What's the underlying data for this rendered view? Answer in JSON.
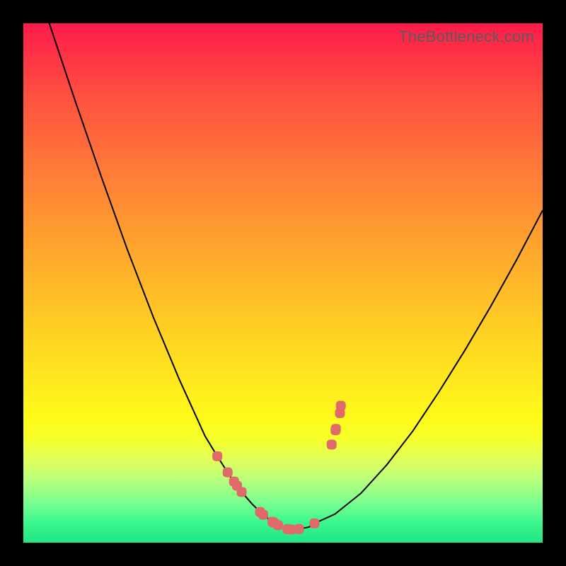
{
  "watermark": "TheBottleneck.com",
  "colors": {
    "frame": "#000000",
    "marker": "#e06a6a",
    "line": "#000000"
  },
  "chart_data": {
    "type": "line",
    "title": "",
    "xlabel": "",
    "ylabel": "",
    "xlim": [
      0,
      100
    ],
    "ylim": [
      0,
      100
    ],
    "grid": false,
    "legend": false,
    "series": [
      {
        "name": "bottleneck-curve",
        "x": [
          0,
          5,
          10,
          15,
          20,
          25,
          30,
          35,
          37.346,
          40,
          42,
          44,
          46,
          48,
          49,
          50,
          51,
          52,
          53,
          55,
          56.061,
          60,
          65,
          70,
          75,
          80,
          85,
          90,
          95,
          100
        ],
        "y": [
          115,
          100,
          85,
          70.5,
          56.5,
          43.5,
          31.5,
          20.5,
          16.638,
          12.5,
          9.8,
          7.5,
          5.5,
          4,
          3.4,
          2.9,
          2.6,
          2.5,
          2.6,
          3,
          3.72,
          5.5,
          9.5,
          15,
          21.5,
          29,
          37,
          45.5,
          54.5,
          64
        ]
      }
    ],
    "markers": [
      {
        "x": 37.346,
        "y": 16.638
      },
      {
        "x": 39.34,
        "y": 13.54
      },
      {
        "x": 40.567,
        "y": 11.77
      },
      {
        "x": 41.146,
        "y": 10.966
      },
      {
        "x": 42.031,
        "y": 9.762
      },
      {
        "x": 45.573,
        "y": 5.909
      },
      {
        "x": 46.185,
        "y": 5.363
      },
      {
        "x": 47.957,
        "y": 4.02
      },
      {
        "x": 48.093,
        "y": 3.93
      },
      {
        "x": 48.229,
        "y": 3.841
      },
      {
        "x": 49.047,
        "y": 3.363
      },
      {
        "x": 50.852,
        "y": 2.62
      },
      {
        "x": 51.567,
        "y": 2.523
      },
      {
        "x": 53.066,
        "y": 2.63
      },
      {
        "x": 56.061,
        "y": 3.72
      },
      {
        "x": 59.364,
        "y": 18.891
      },
      {
        "x": 60.113,
        "y": 21.648
      },
      {
        "x": 60.181,
        "y": 21.905
      },
      {
        "x": 60.965,
        "y": 24.952
      },
      {
        "x": 61.135,
        "y": 26.36
      }
    ],
    "annotations": []
  }
}
